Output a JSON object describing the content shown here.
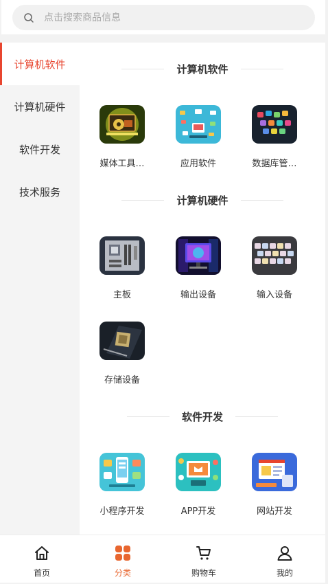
{
  "search": {
    "placeholder": "点击搜索商品信息"
  },
  "sidebar": {
    "items": [
      {
        "label": "计算机软件",
        "active": true
      },
      {
        "label": "计算机硬件",
        "active": false
      },
      {
        "label": "软件开发",
        "active": false
      },
      {
        "label": "技术服务",
        "active": false
      }
    ]
  },
  "sections": [
    {
      "title": "计算机软件",
      "items": [
        {
          "label": "媒体工具…",
          "icon": "media-tools-image"
        },
        {
          "label": "应用软件",
          "icon": "app-software-image"
        },
        {
          "label": "数据库管…",
          "icon": "database-image"
        }
      ]
    },
    {
      "title": "计算机硬件",
      "items": [
        {
          "label": "主板",
          "icon": "motherboard-image"
        },
        {
          "label": "输出设备",
          "icon": "output-device-image"
        },
        {
          "label": "输入设备",
          "icon": "keyboard-image"
        },
        {
          "label": "存储设备",
          "icon": "storage-chip-image"
        }
      ]
    },
    {
      "title": "软件开发",
      "items": [
        {
          "label": "小程序开发",
          "icon": "mini-program-image"
        },
        {
          "label": "APP开发",
          "icon": "app-dev-image"
        },
        {
          "label": "网站开发",
          "icon": "website-dev-image"
        }
      ]
    }
  ],
  "tabbar": {
    "items": [
      {
        "label": "首页",
        "icon": "home-icon",
        "active": false
      },
      {
        "label": "分类",
        "icon": "category-icon",
        "active": true
      },
      {
        "label": "购物车",
        "icon": "cart-icon",
        "active": false
      },
      {
        "label": "我的",
        "icon": "user-icon",
        "active": false
      }
    ]
  },
  "colors": {
    "accent": "#e8452f",
    "tab_active": "#e8662f"
  }
}
